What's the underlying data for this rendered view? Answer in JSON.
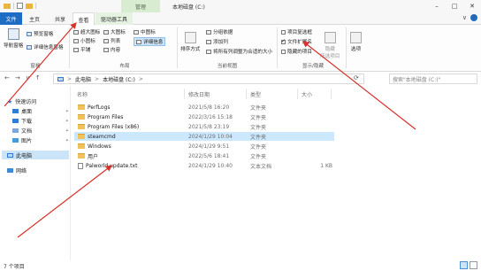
{
  "window": {
    "title": "本地磁盘 (C:)",
    "manage_tab_header": "管理",
    "minimize_glyph": "–",
    "maximize_glyph": "□",
    "close_glyph": "✕"
  },
  "tabs": {
    "file": "文件",
    "home": "主页",
    "share": "共享",
    "view": "查看",
    "app_tools": "驱动器工具",
    "collapse_glyph": "∨",
    "help_glyph": "?"
  },
  "ribbon": {
    "panes": {
      "nav_pane": "导航窗格",
      "preview_pane": "预览窗格",
      "details_pane": "详细信息窗格",
      "label": "窗格"
    },
    "layout": {
      "extra_large": "超大图标",
      "large": "大图标",
      "medium": "中图标",
      "small": "小图标",
      "list": "列表",
      "details": "详细信息",
      "tiles": "平铺",
      "content": "内容",
      "label": "布局"
    },
    "current_view": {
      "sort_by": "排序方式",
      "group_by": "分组依据",
      "add_columns": "添加列",
      "size_columns": "将所有列调整为合适的大小",
      "label": "当前视图"
    },
    "show_hide": {
      "item_checkboxes": "项目复选框",
      "file_ext": "文件扩展名",
      "hidden_items": "隐藏的项目",
      "hide_selected": "隐藏",
      "hide_selected_2": "所选项目",
      "label": "显示/隐藏",
      "item_checkboxes_checked": false,
      "file_ext_checked": true,
      "hidden_items_checked": false
    },
    "options": "选项"
  },
  "address": {
    "back_glyph": "←",
    "forward_glyph": "→",
    "recent_glyph": "∨",
    "up_glyph": "↑",
    "crumbs": [
      "此电脑",
      "本地磁盘 (C:)"
    ],
    "crumb_sep": ">",
    "refresh_glyph": "⟳",
    "search_placeholder": "搜索\"本地磁盘 (C:)\""
  },
  "sidebar": {
    "quick_access": "快速访问",
    "items": [
      {
        "label": "桌面"
      },
      {
        "label": "下载"
      },
      {
        "label": "文档"
      },
      {
        "label": "图片"
      }
    ],
    "this_pc": "此电脑",
    "network": "网络"
  },
  "columns": {
    "name": "名称",
    "date": "修改日期",
    "type": "类型",
    "size": "大小"
  },
  "files": [
    {
      "name": "PerfLogs",
      "date": "2021/5/8 16:20",
      "type": "文件夹",
      "size": "",
      "kind": "folder"
    },
    {
      "name": "Program Files",
      "date": "2022/3/16 15:18",
      "type": "文件夹",
      "size": "",
      "kind": "folder"
    },
    {
      "name": "Program Files (x86)",
      "date": "2021/5/8 23:19",
      "type": "文件夹",
      "size": "",
      "kind": "folder"
    },
    {
      "name": "steamcmd",
      "date": "2024/1/29 10:04",
      "type": "文件夹",
      "size": "",
      "kind": "folder",
      "selected": true
    },
    {
      "name": "Windows",
      "date": "2024/1/29 9:51",
      "type": "文件夹",
      "size": "",
      "kind": "folder"
    },
    {
      "name": "用户",
      "date": "2022/5/6 18:41",
      "type": "文件夹",
      "size": "",
      "kind": "folder"
    },
    {
      "name": "Palworld update.txt",
      "date": "2024/1/29 10:40",
      "type": "文本文档",
      "size": "1 KB",
      "kind": "text"
    }
  ],
  "status": {
    "count": "7 个项目"
  },
  "colors": {
    "accent": "#1f6cc4",
    "selection": "#cce8ff",
    "folder": "#f0c25a",
    "annotation": "#d8302a"
  }
}
